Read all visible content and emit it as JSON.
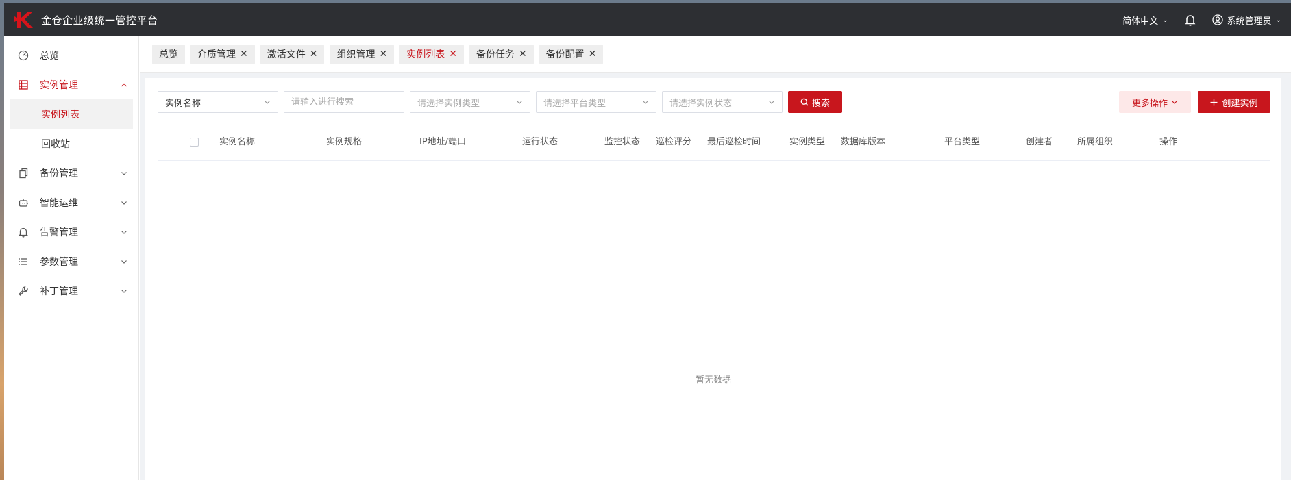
{
  "app": {
    "title": "金仓企业级统一管控平台",
    "brand_color": "#c8161d"
  },
  "header": {
    "language": "简体中文",
    "user": "系统管理员",
    "icons": [
      "bell-icon",
      "user-circle-icon"
    ]
  },
  "sidebar": {
    "items": [
      {
        "label": "总览",
        "icon": "dashboard-icon"
      },
      {
        "label": "实例管理",
        "icon": "list-table-icon",
        "expanded": true,
        "children": [
          {
            "label": "实例列表",
            "selected": true
          },
          {
            "label": "回收站"
          }
        ]
      },
      {
        "label": "备份管理",
        "icon": "copy-icon"
      },
      {
        "label": "智能运维",
        "icon": "robot-icon"
      },
      {
        "label": "告警管理",
        "icon": "bell-icon"
      },
      {
        "label": "参数管理",
        "icon": "list-icon"
      },
      {
        "label": "补丁管理",
        "icon": "wrench-icon"
      }
    ]
  },
  "tabs": [
    {
      "label": "总览",
      "closable": false
    },
    {
      "label": "介质管理",
      "closable": true
    },
    {
      "label": "激活文件",
      "closable": true
    },
    {
      "label": "组织管理",
      "closable": true
    },
    {
      "label": "实例列表",
      "closable": true,
      "active": true
    },
    {
      "label": "备份任务",
      "closable": true
    },
    {
      "label": "备份配置",
      "closable": true
    }
  ],
  "filters": {
    "field_select": "实例名称",
    "search_placeholder": "请输入进行搜索",
    "instance_type_placeholder": "请选择实例类型",
    "platform_type_placeholder": "请选择平台类型",
    "instance_status_placeholder": "请选择实例状态",
    "search_button": "搜索",
    "more_actions": "更多操作",
    "create_instance": "创建实例"
  },
  "table": {
    "columns": [
      "实例名称",
      "实例规格",
      "IP地址/端口",
      "运行状态",
      "监控状态",
      "巡检评分",
      "最后巡检时间",
      "实例类型",
      "数据库版本",
      "平台类型",
      "创建者",
      "所属组织",
      "操作"
    ],
    "rows": [],
    "empty_text": "暂无数据"
  }
}
